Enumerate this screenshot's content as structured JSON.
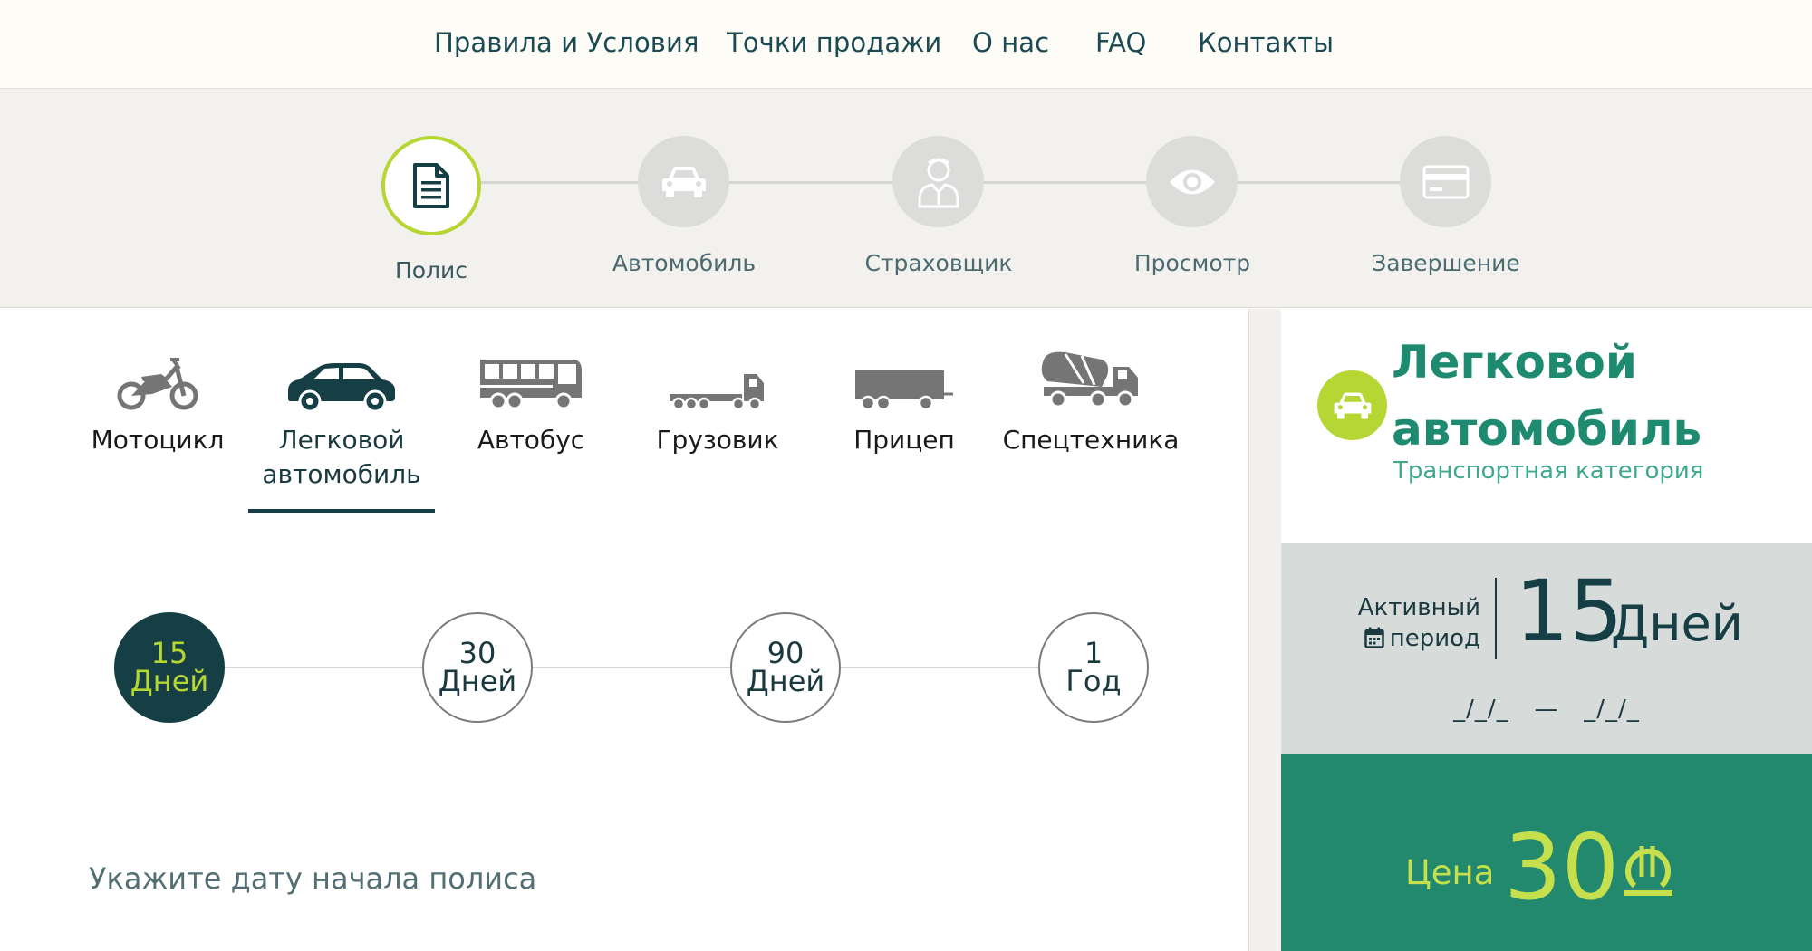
{
  "nav": {
    "items": [
      "Правила и Условия",
      "Точки продажи",
      "О нас",
      "FAQ",
      "Контакты"
    ]
  },
  "steps": [
    {
      "label": "Полис",
      "icon": "document-icon",
      "active": true
    },
    {
      "label": "Автомобиль",
      "icon": "car-icon",
      "active": false
    },
    {
      "label": "Страховщик",
      "icon": "person-icon",
      "active": false
    },
    {
      "label": "Просмотр",
      "icon": "eye-icon",
      "active": false
    },
    {
      "label": "Завершение",
      "icon": "credit-card-icon",
      "active": false
    }
  ],
  "vehicles": [
    {
      "label": "Мотоцикл",
      "icon": "motorcycle-icon",
      "active": false
    },
    {
      "label": "Легковой автомобиль",
      "icon": "car-icon",
      "active": true
    },
    {
      "label": "Автобус",
      "icon": "bus-icon",
      "active": false
    },
    {
      "label": "Грузовик",
      "icon": "truck-icon",
      "active": false
    },
    {
      "label": "Прицеп",
      "icon": "trailer-icon",
      "active": false
    },
    {
      "label": "Спецтехника",
      "icon": "concrete-mixer-icon",
      "active": false
    }
  ],
  "periods": [
    {
      "num": "15",
      "unit": "Дней",
      "active": true
    },
    {
      "num": "30",
      "unit": "Дней",
      "active": false
    },
    {
      "num": "90",
      "unit": "Дней",
      "active": false
    },
    {
      "num": "1",
      "unit": "Год",
      "active": false
    }
  ],
  "start_date_label": "Укажите дату начала полиса",
  "summary": {
    "category_name": "Легковой автомобиль",
    "category_sub": "Транспортная категория",
    "active_period_label_1": "Активный",
    "active_period_label_2": "период",
    "period_num": "15",
    "period_unit": "Дней",
    "date_from": "_/_/_",
    "date_sep": "—",
    "date_to": "_/_/_",
    "price_label": "Цена",
    "price_value": "30",
    "currency_icon": "lari-currency-icon"
  },
  "colors": {
    "accent_green": "#b5d633",
    "dark_teal": "#163f45",
    "price_bg": "#22896e",
    "category_text": "#1e8a6f"
  }
}
